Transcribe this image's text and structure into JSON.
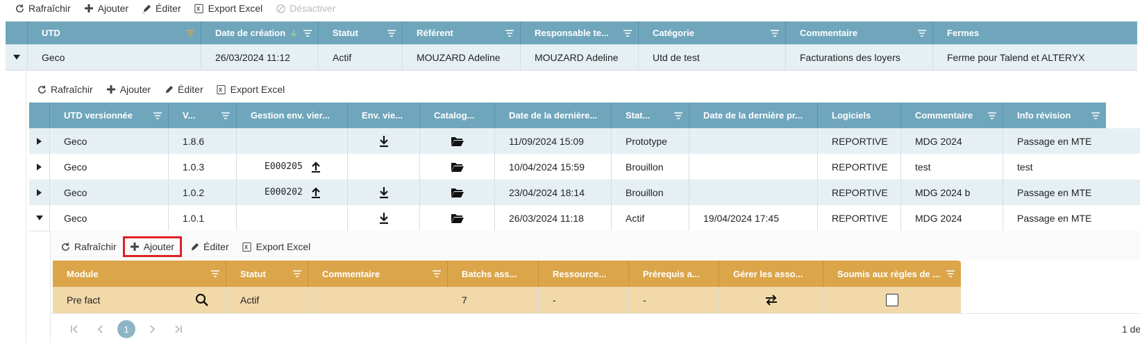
{
  "toolbar1": {
    "refresh": "Rafraîchir",
    "add": "Ajouter",
    "edit": "Éditer",
    "export": "Export Excel",
    "disable": "Désactiver"
  },
  "grid1": {
    "headers": [
      "UTD",
      "Date de création",
      "Statut",
      "Référent",
      "Responsable te...",
      "Catégorie",
      "Commentaire",
      "Fermes"
    ],
    "row": [
      "Geco",
      "26/03/2024 11:12",
      "Actif",
      "MOUZARD Adeline",
      "MOUZARD Adeline",
      "Utd de test",
      "Facturations des loyers",
      "Ferme pour Talend et ALTERYX"
    ]
  },
  "toolbar2": {
    "refresh": "Rafraîchir",
    "add": "Ajouter",
    "edit": "Éditer",
    "export": "Export Excel"
  },
  "grid2": {
    "headers": [
      "UTD versionnée",
      "V...",
      "Gestion env. vier...",
      "Env. vie...",
      "Catalog...",
      "Date de la dernière...",
      "Stat...",
      "Date de la dernière pr...",
      "Logiciels",
      "Commentaire",
      "Info révision"
    ],
    "rows": [
      {
        "utd": "Geco",
        "version": "1.8.6",
        "env": "",
        "status": "Prototype",
        "date": "11/09/2024 15:09",
        "date2": "",
        "log": "REPORTIVE",
        "comment": "MDG 2024",
        "info": "Passage en MTE"
      },
      {
        "utd": "Geco",
        "version": "1.0.3",
        "env": "E000205",
        "status": "Brouillon",
        "date": "10/04/2024 15:59",
        "date2": "",
        "log": "REPORTIVE",
        "comment": "test",
        "info": "test"
      },
      {
        "utd": "Geco",
        "version": "1.0.2",
        "env": "E000202",
        "status": "Brouillon",
        "date": "23/04/2024 18:14",
        "date2": "",
        "log": "REPORTIVE",
        "comment": "MDG 2024 b",
        "info": "Passage en MTE"
      },
      {
        "utd": "Geco",
        "version": "1.0.1",
        "env": "",
        "status": "Actif",
        "date": "26/03/2024 11:18",
        "date2": "19/04/2024 17:45",
        "log": "REPORTIVE",
        "comment": "MDG 2024",
        "info": "Passage en MTE"
      }
    ]
  },
  "toolbar3": {
    "refresh": "Rafraîchir",
    "add": "Ajouter",
    "edit": "Éditer",
    "export": "Export Excel"
  },
  "grid3": {
    "headers": [
      "Module",
      "Statut",
      "Commentaire",
      "Batchs ass...",
      "Ressource...",
      "Prérequis a...",
      "Gérer les asso...",
      "Soumis aux règles de ..."
    ],
    "row": {
      "module": "Pre fact",
      "status": "Actif",
      "comment": "",
      "batchs": "7",
      "resources": "-",
      "prereq": "-"
    }
  },
  "pager": {
    "page": "1",
    "count_text": "1 de"
  },
  "colors": {
    "teal_header": "#6fa6bc",
    "gold_header": "#dba54a",
    "row_blue": "#e6f0f4",
    "row_gold": "#f2d9a9",
    "highlight": "#e01f26"
  }
}
